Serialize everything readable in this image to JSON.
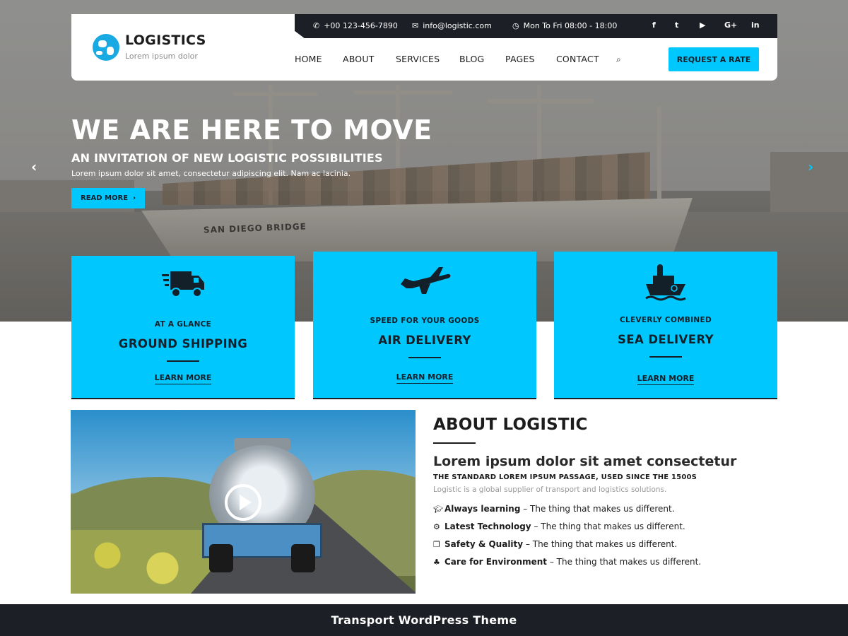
{
  "header": {
    "logo_title": "LOGISTICS",
    "logo_tagline": "Lorem ipsum dolor",
    "phone": "+00 123-456-7890",
    "email": "info@logistic.com",
    "hours": "Mon To Fri 08:00 - 18:00",
    "social": [
      "f",
      "t",
      "▶",
      "G+",
      "in"
    ],
    "nav": [
      "HOME",
      "ABOUT",
      "SERVICES",
      "BLOG",
      "PAGES",
      "CONTACT"
    ],
    "cta": "REQUEST A RATE"
  },
  "hero": {
    "title": "WE ARE HERE TO MOVE",
    "subtitle": "AN INVITATION OF NEW LOGISTIC POSSIBILITIES",
    "description": "Lorem ipsum dolor sit amet, consectetur adipiscing elit. Nam ac lacinia.",
    "button": "READ MORE",
    "ship_name": "SAN DIEGO BRIDGE",
    "prev_icon": "chevron-left-icon",
    "next_icon": "chevron-right-icon"
  },
  "services": [
    {
      "icon": "truck-icon",
      "kicker": "AT A GLANCE",
      "title": "GROUND SHIPPING",
      "link": "LEARN MORE"
    },
    {
      "icon": "airplane-icon",
      "kicker": "SPEED FOR YOUR GOODS",
      "title": "AIR DELIVERY",
      "link": "LEARN MORE"
    },
    {
      "icon": "ship-icon",
      "kicker": "CLEVERLY COMBINED",
      "title": "SEA DELIVERY",
      "link": "LEARN MORE"
    }
  ],
  "about": {
    "title_part1": "ABOUT ",
    "title_part2": "LOGISTIC",
    "heading": "Lorem ipsum dolor sit amet consectetur",
    "subheading": "THE STANDARD LOREM IPSUM PASSAGE, USED SINCE THE 1500S",
    "description": "Logistic is a global supplier of transport and logistics solutions.",
    "features": [
      {
        "icon": "graduation-cap-icon",
        "label": "Always learning",
        "rest": " – The thing that makes us different."
      },
      {
        "icon": "gears-icon",
        "label": "Latest Technology",
        "rest": " – The thing that makes us different."
      },
      {
        "icon": "cubes-icon",
        "label": "Safety & Quality",
        "rest": " – The thing that makes us different."
      },
      {
        "icon": "tree-icon",
        "label": "Care for Environment",
        "rest": " – The thing that makes us different."
      }
    ]
  },
  "footer": {
    "text": "Transport WordPress Theme"
  },
  "colors": {
    "accent": "#00c8ff",
    "dark": "#1d1f26",
    "logo_blue": "#19a9e3"
  }
}
